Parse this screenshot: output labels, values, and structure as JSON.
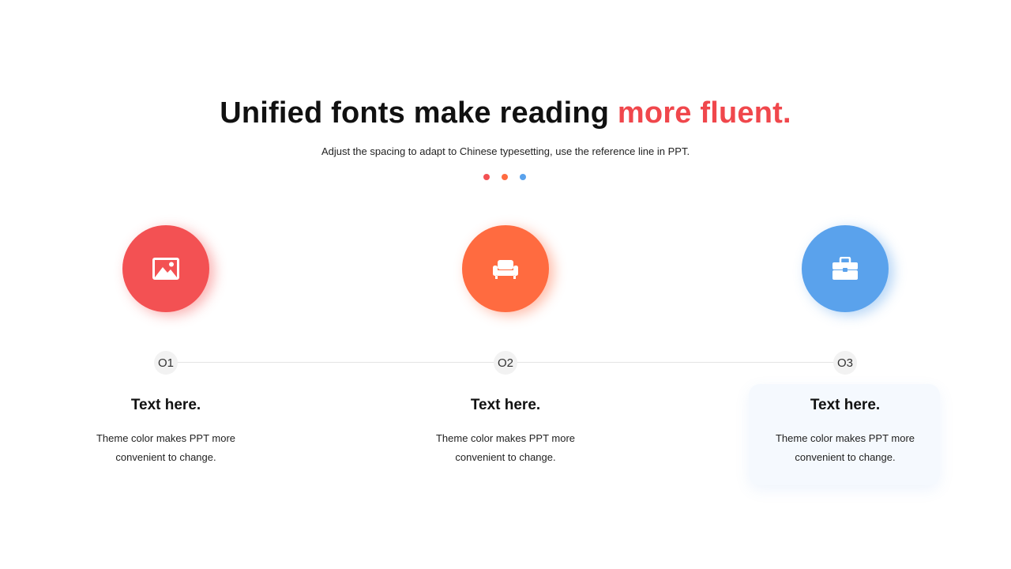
{
  "title": {
    "main": "Unified fonts make reading ",
    "accent": "more fluent."
  },
  "subtitle": "Adjust the spacing to adapt to Chinese typesetting, use the reference line in PPT.",
  "colors": {
    "red": "#f35153",
    "orange": "#ff6b40",
    "blue": "#5aa2ec",
    "accent_text": "#f0474c"
  },
  "items": [
    {
      "number": "O1",
      "icon": "image-icon",
      "heading": "Text here.",
      "desc_line1": "Theme color makes PPT more",
      "desc_line2": "convenient to change."
    },
    {
      "number": "O2",
      "icon": "sofa-icon",
      "heading": "Text here.",
      "desc_line1": "Theme color makes PPT more",
      "desc_line2": "convenient to change."
    },
    {
      "number": "O3",
      "icon": "briefcase-icon",
      "heading": "Text here.",
      "desc_line1": "Theme color makes PPT more",
      "desc_line2": "convenient to change."
    }
  ]
}
